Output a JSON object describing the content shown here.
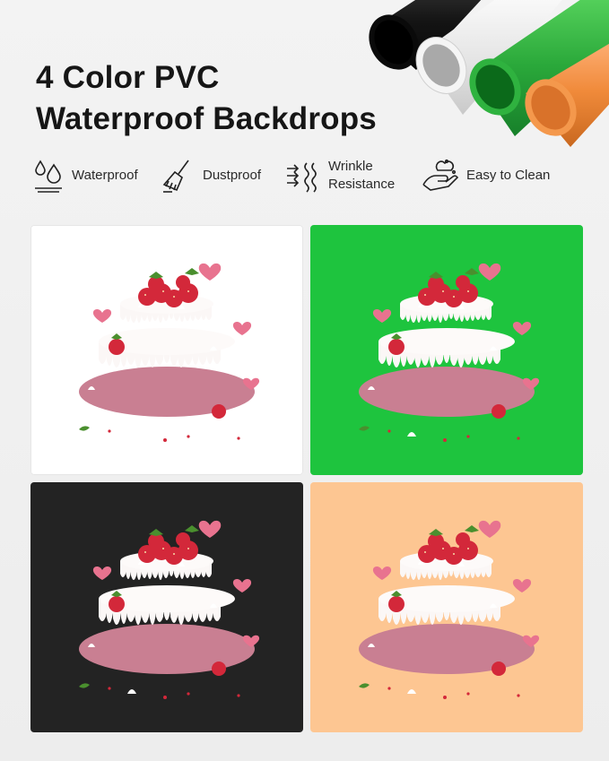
{
  "title": {
    "line1": "4 Color PVC",
    "line2": "Waterproof Backdrops"
  },
  "features": [
    {
      "icon": "water-drops-icon",
      "label": "Waterproof"
    },
    {
      "icon": "brush-icon",
      "label": "Dustproof"
    },
    {
      "icon": "wrinkle-icon",
      "label_line1": "Wrinkle",
      "label_line2": "Resistance"
    },
    {
      "icon": "hand-cleaning-icon",
      "label": "Easy to Clean"
    }
  ],
  "backdrop_colors": {
    "white": "#ffffff",
    "green": "#1ec43e",
    "black": "#232323",
    "orange": "#fdc692"
  },
  "tube_colors": [
    "#121212",
    "#e7e7e7",
    "#2aa83a",
    "#f08a3a"
  ]
}
